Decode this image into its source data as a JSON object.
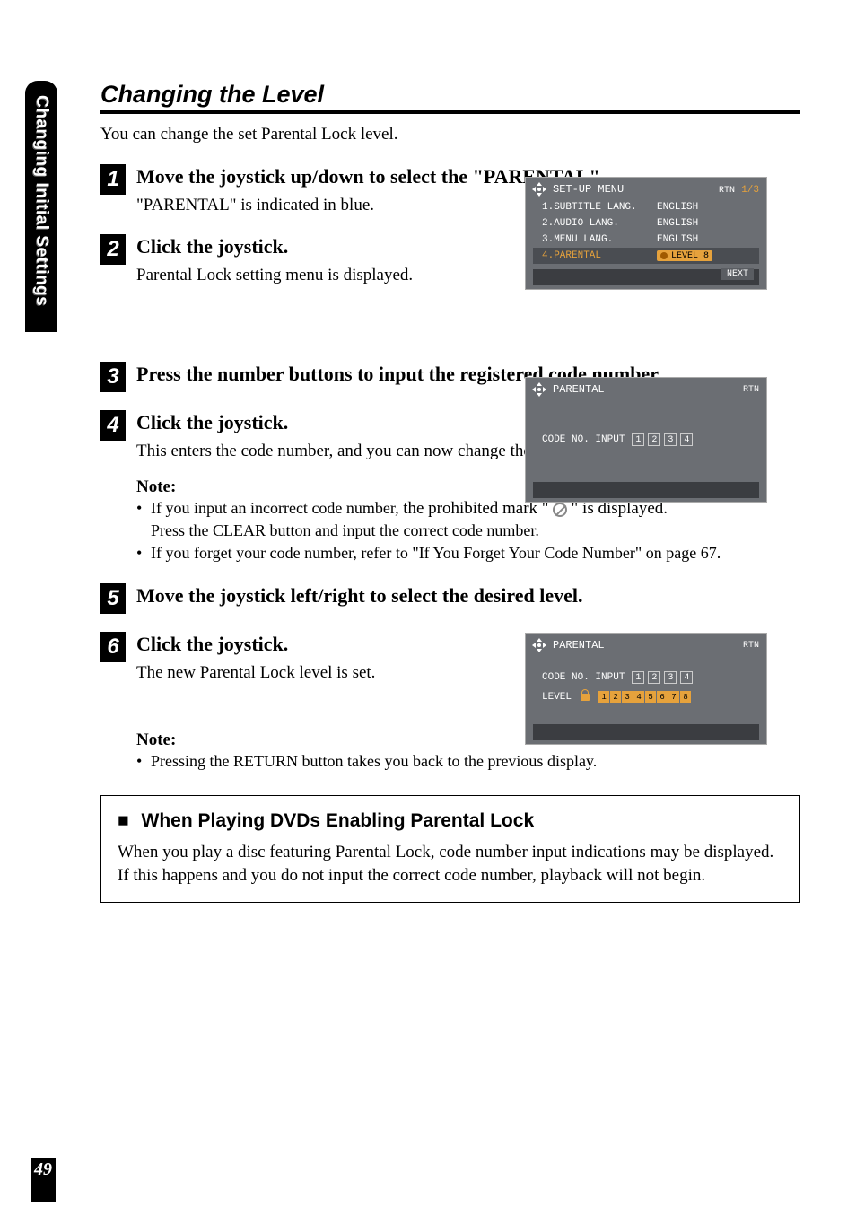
{
  "sideTab": "Changing Initial Settings",
  "pageNumber": "49",
  "section": {
    "title": "Changing the Level",
    "intro": "You can change the set Parental Lock level."
  },
  "steps": [
    {
      "num": "1",
      "title": "Move the joystick up/down to select the \"PARENTAL\".",
      "desc": "\"PARENTAL\" is indicated in blue."
    },
    {
      "num": "2",
      "title": "Click the joystick.",
      "desc": "Parental Lock setting menu is displayed."
    },
    {
      "num": "3",
      "title": "Press the number buttons to input the registered code number.",
      "desc": ""
    },
    {
      "num": "4",
      "title": "Click the joystick.",
      "desc": "This enters the code number, and you can now change the level."
    },
    {
      "num": "5",
      "title": "Move the joystick left/right to select the desired level.",
      "desc": ""
    },
    {
      "num": "6",
      "title": "Click the joystick.",
      "desc": "The new Parental Lock level is set."
    }
  ],
  "note1": {
    "label": "Note:",
    "bullet1_a": "If you input an incorrect code number,  ",
    "bullet1_b": "the prohibited mark \"",
    "bullet1_c": "\" is displayed.",
    "sub": "Press the CLEAR button and input the correct code number.",
    "bullet2": "If you forget your code number, refer to \"If You Forget Your Code Number\" on page 67."
  },
  "note2": {
    "label": "Note:",
    "bullet": "Pressing the RETURN button takes you back to the previous display."
  },
  "box": {
    "marker": "■",
    "heading": "When Playing DVDs Enabling Parental Lock",
    "text": "When you play a disc featuring Parental Lock, code number input indications may be displayed. If this happens and you do not input the correct code number, playback will not begin."
  },
  "screen1": {
    "title": "SET-UP MENU",
    "rtn": "RTN",
    "page": "1/3",
    "rows": [
      {
        "label": "1.SUBTITLE LANG.",
        "value": "ENGLISH"
      },
      {
        "label": "2.AUDIO LANG.",
        "value": "ENGLISH"
      },
      {
        "label": "3.MENU LANG.",
        "value": "ENGLISH"
      },
      {
        "label": "4.PARENTAL",
        "value": "LEVEL 8"
      }
    ],
    "next": "NEXT"
  },
  "screen2": {
    "title": "PARENTAL",
    "rtn": "RTN",
    "codeLabel": "CODE NO. INPUT",
    "digits": [
      "1",
      "2",
      "3",
      "4"
    ]
  },
  "screen3": {
    "title": "PARENTAL",
    "rtn": "RTN",
    "codeLabel": "CODE NO. INPUT",
    "digits": [
      "1",
      "2",
      "3",
      "4"
    ],
    "levelLabel": "LEVEL",
    "levels": [
      "1",
      "2",
      "3",
      "4",
      "5",
      "6",
      "7",
      "8"
    ]
  }
}
